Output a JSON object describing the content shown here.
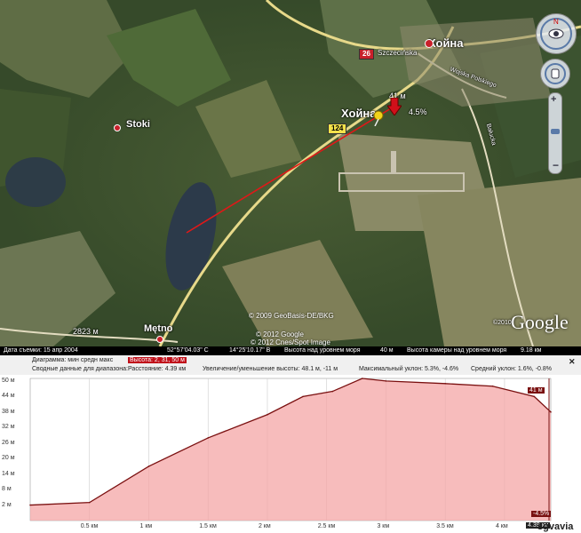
{
  "map": {
    "places": {
      "khoyna_top": "Хойна",
      "khoyna_mid": "Хойна",
      "stoki": "Stoki",
      "metno": "Mętno",
      "street1": "Szczecińska",
      "street2": "Wojska Polskiego",
      "street3": "Bałucka"
    },
    "roads": {
      "r26": "26",
      "r124": "124"
    },
    "markers": {
      "elev": "41 м",
      "slope": "4.5%",
      "hill_elev": "2823 м"
    },
    "credits": {
      "c1": "© 2009 GeoBasis-DE/BKG",
      "c2": "© 2012 Google",
      "c3": "© 2012 Cnes/Spot Image"
    },
    "logo": "Google",
    "logo_year": "©2010"
  },
  "status": {
    "date": "Дата съемки: 15 апр 2004",
    "lat": "52°57'04.03\" С",
    "lon": "14°25'10.17\" В",
    "alt": "Высота над уровнем моря",
    "alt_val": "40 м",
    "cam": "Высота камеры над уровнем моря",
    "cam_val": "9.18 км"
  },
  "toolbar": {
    "row1_label": "Диаграмма: мин  средн  макс",
    "row1_box": "Высота: 2, 31, 50 м",
    "row2_label": "Сводные данные для диапазона:",
    "distance": "Расстояние: 4.39 км",
    "gain": "Увеличение/уменьшение высоты: 48.1 м, -11 м",
    "maxslope": "Максимальный уклон: 5.3%, -4.6%",
    "avgslope": "Средний уклон: 1.6%, -0.8%",
    "close": "✕"
  },
  "profile": {
    "cursor_elev": "41 м",
    "cursor_slope": "-4.5%",
    "cursor_dist": "4.39 км"
  },
  "chart_data": {
    "type": "area",
    "y_ticks": [
      "50 м",
      "44 м",
      "38 м",
      "32 м",
      "26 м",
      "20 м",
      "14 м",
      "8 м",
      "2 м"
    ],
    "x_ticks": [
      "0.5 км",
      "1 км",
      "1.5 км",
      "2 км",
      "2.5 км",
      "3 км",
      "3.5 км",
      "4 км"
    ],
    "x": [
      0,
      0.5,
      1,
      1.5,
      2,
      2.3,
      2.55,
      2.8,
      3.0,
      3.5,
      3.9,
      4.25,
      4.39
    ],
    "y": [
      2,
      3,
      17,
      28,
      37,
      44,
      46,
      51,
      50,
      49,
      48,
      44,
      38
    ],
    "xlim": [
      0,
      4.39
    ],
    "ylim": [
      -4,
      51
    ],
    "xlabel": "",
    "ylabel": "",
    "fill": "#f4a6a6",
    "line": "#7a1010"
  },
  "watermark": "sgvavia"
}
